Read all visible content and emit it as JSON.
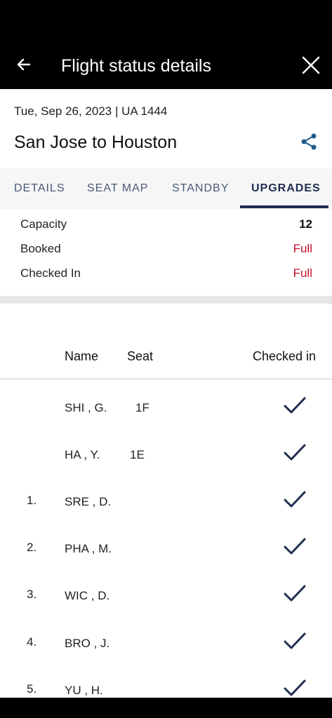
{
  "app_bar": {
    "title": "Flight status details",
    "back_icon": "arrow-left-icon",
    "close_icon": "close-icon"
  },
  "flight": {
    "date_line": "Tue, Sep 26, 2023 | UA 1444",
    "route": "San Jose to Houston",
    "share_icon": "share-icon"
  },
  "tabs": [
    {
      "label": "DETAILS",
      "active": false
    },
    {
      "label": "SEAT MAP",
      "active": false
    },
    {
      "label": "STANDBY",
      "active": false
    },
    {
      "label": "UPGRADES",
      "active": true
    }
  ],
  "summary": {
    "capacity_label": "Capacity",
    "capacity_value": "12",
    "booked_label": "Booked",
    "booked_value": "Full",
    "checked_in_label": "Checked In",
    "checked_in_value": "Full"
  },
  "table": {
    "headers": {
      "name": "Name",
      "seat": "Seat",
      "checked_in": "Checked in"
    },
    "rows": [
      {
        "num": "",
        "name": "SHI , G.",
        "seat": "1F",
        "checked_in": true
      },
      {
        "num": "",
        "name": "HA , Y.",
        "seat": "1E",
        "checked_in": true
      },
      {
        "num": "1.",
        "name": "SRE , D.",
        "seat": "",
        "checked_in": true
      },
      {
        "num": "2.",
        "name": "PHA , M.",
        "seat": "",
        "checked_in": true
      },
      {
        "num": "3.",
        "name": "WIC , D.",
        "seat": "",
        "checked_in": true
      },
      {
        "num": "4.",
        "name": "BRO , J.",
        "seat": "",
        "checked_in": true
      },
      {
        "num": "5.",
        "name": "YU , H.",
        "seat": "",
        "checked_in": true
      }
    ]
  },
  "colors": {
    "navy": "#1f2d4f",
    "red": "#c8102e",
    "tab_bg": "#f6f6f7"
  }
}
